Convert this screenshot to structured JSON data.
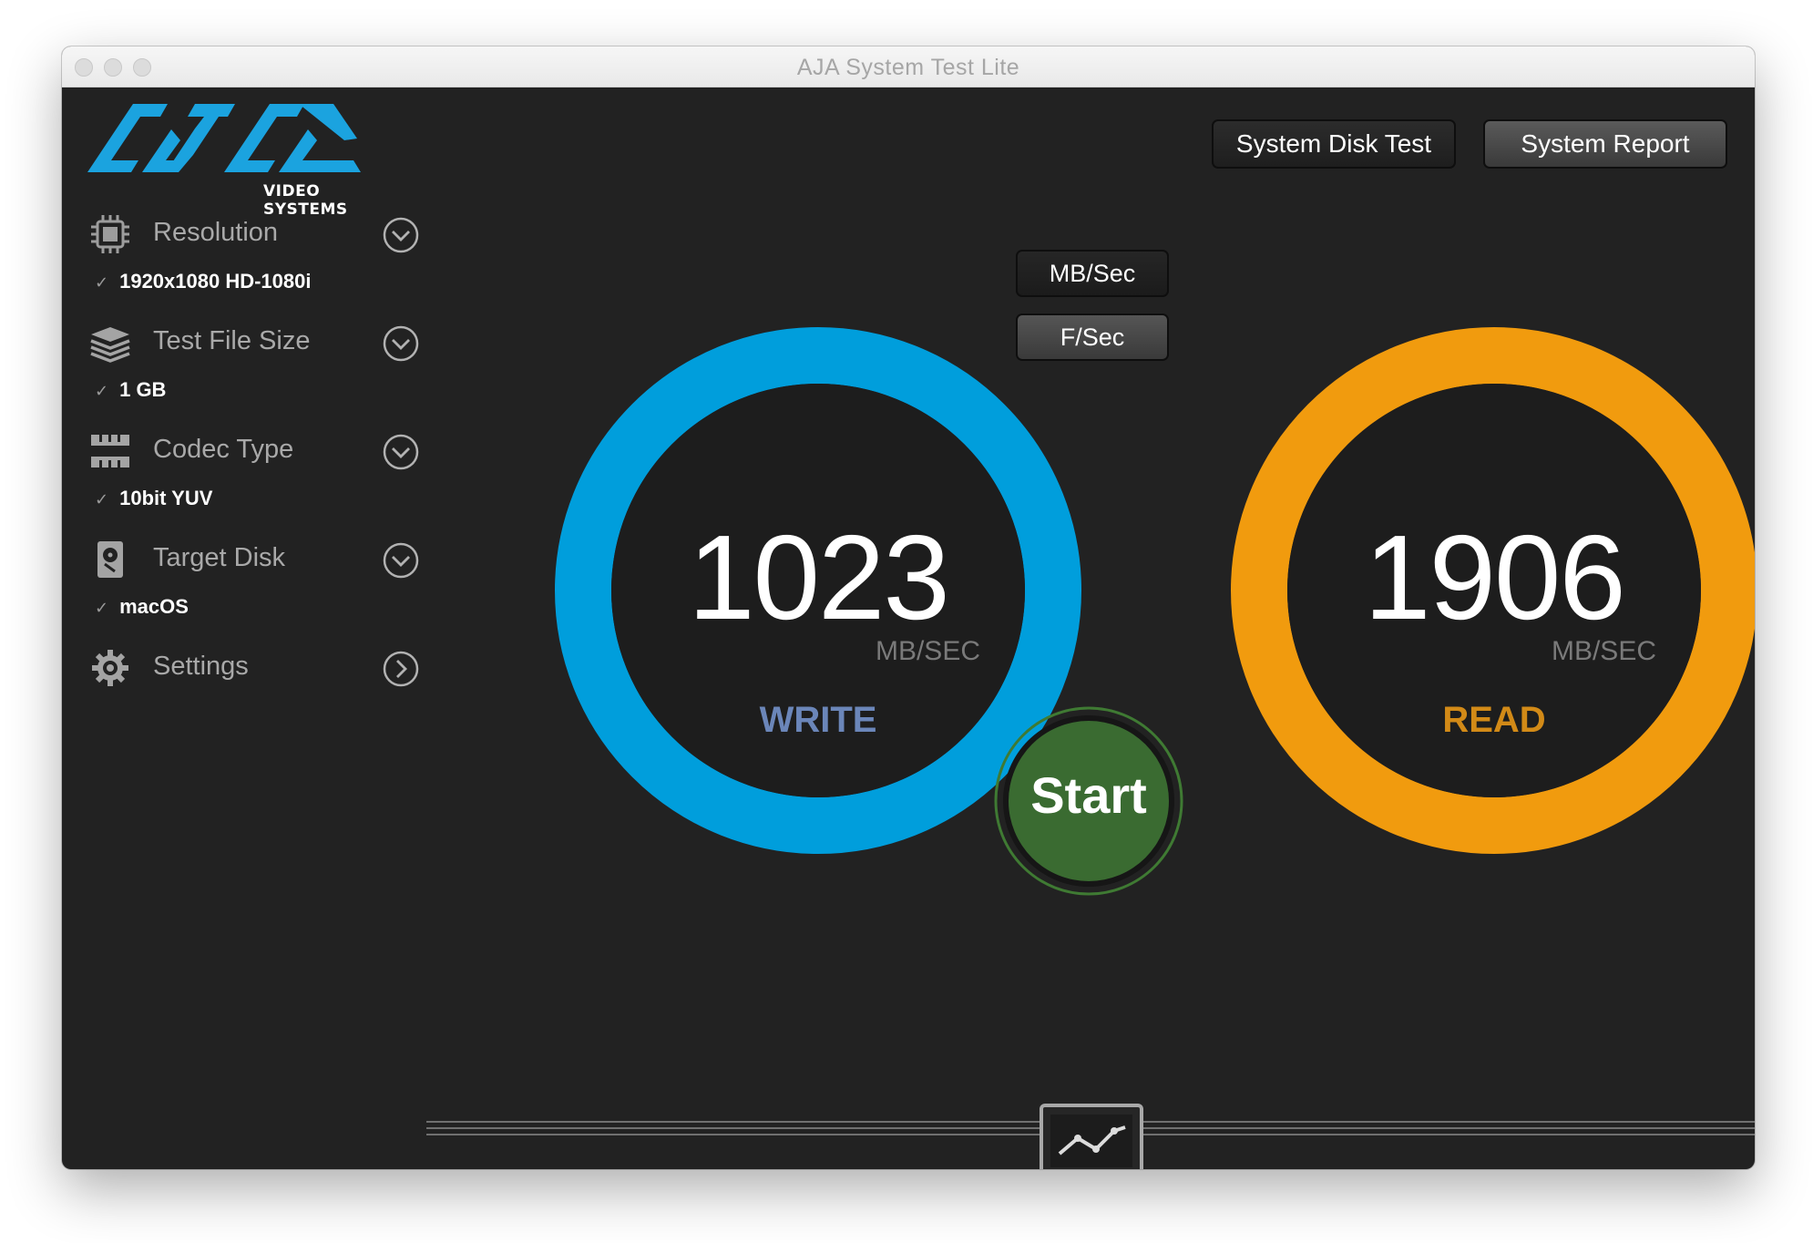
{
  "window": {
    "title": "AJA System Test Lite"
  },
  "logo": {
    "main": "AJA",
    "sub": "VIDEO SYSTEMS"
  },
  "sidebar": {
    "items": [
      {
        "label": "Resolution",
        "icon": "chip-icon",
        "selected": "1920x1080 HD-1080i",
        "indicator": "chevron-down-icon"
      },
      {
        "label": "Test File Size",
        "icon": "layers-icon",
        "selected": "1 GB",
        "indicator": "chevron-down-icon"
      },
      {
        "label": "Codec Type",
        "icon": "film-strip-icon",
        "selected": "10bit YUV",
        "indicator": "chevron-down-icon"
      },
      {
        "label": "Target Disk",
        "icon": "hard-disk-icon",
        "selected": "macOS",
        "indicator": "chevron-down-icon"
      },
      {
        "label": "Settings",
        "icon": "gear-icon",
        "indicator": "chevron-right-icon"
      }
    ],
    "check_mark": "✓"
  },
  "toolbar": {
    "disk_test_label": "System Disk Test",
    "report_label": "System Report"
  },
  "units": {
    "mb_sec_label": "MB/Sec",
    "f_sec_label": "F/Sec"
  },
  "write": {
    "value": "1023",
    "unit": "MB/SEC",
    "label": "WRITE",
    "ring_color": "#009edc",
    "label_color": "#6b86b9"
  },
  "read": {
    "value": "1906",
    "unit": "MB/SEC",
    "label": "READ",
    "ring_color": "#f19b0e",
    "label_color": "#d28a17"
  },
  "start": {
    "label": "Start",
    "color": "#3a6b31"
  },
  "graph_toggle": {
    "icon": "line-chart-icon"
  }
}
